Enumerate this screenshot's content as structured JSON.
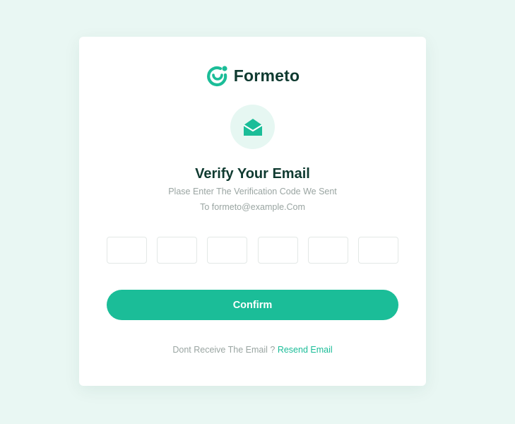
{
  "brand": {
    "name": "Formeto",
    "logo_icon": "formeto-logo-icon"
  },
  "verify": {
    "icon": "envelope-open-icon",
    "title": "Verify Your Email",
    "subtitle_line1": "Plase Enter The Verification Code We Sent",
    "subtitle_line2": "To formeto@example.Com"
  },
  "code_inputs": [
    "",
    "",
    "",
    "",
    "",
    ""
  ],
  "actions": {
    "confirm_label": "Confirm"
  },
  "footer": {
    "prompt": "Dont Receive The Email ?",
    "resend_label": "Resend Email"
  },
  "colors": {
    "background": "#e9f7f3",
    "accent": "#1bbd98",
    "text_dark": "#0f3a30",
    "text_muted": "#9aa5a2"
  }
}
